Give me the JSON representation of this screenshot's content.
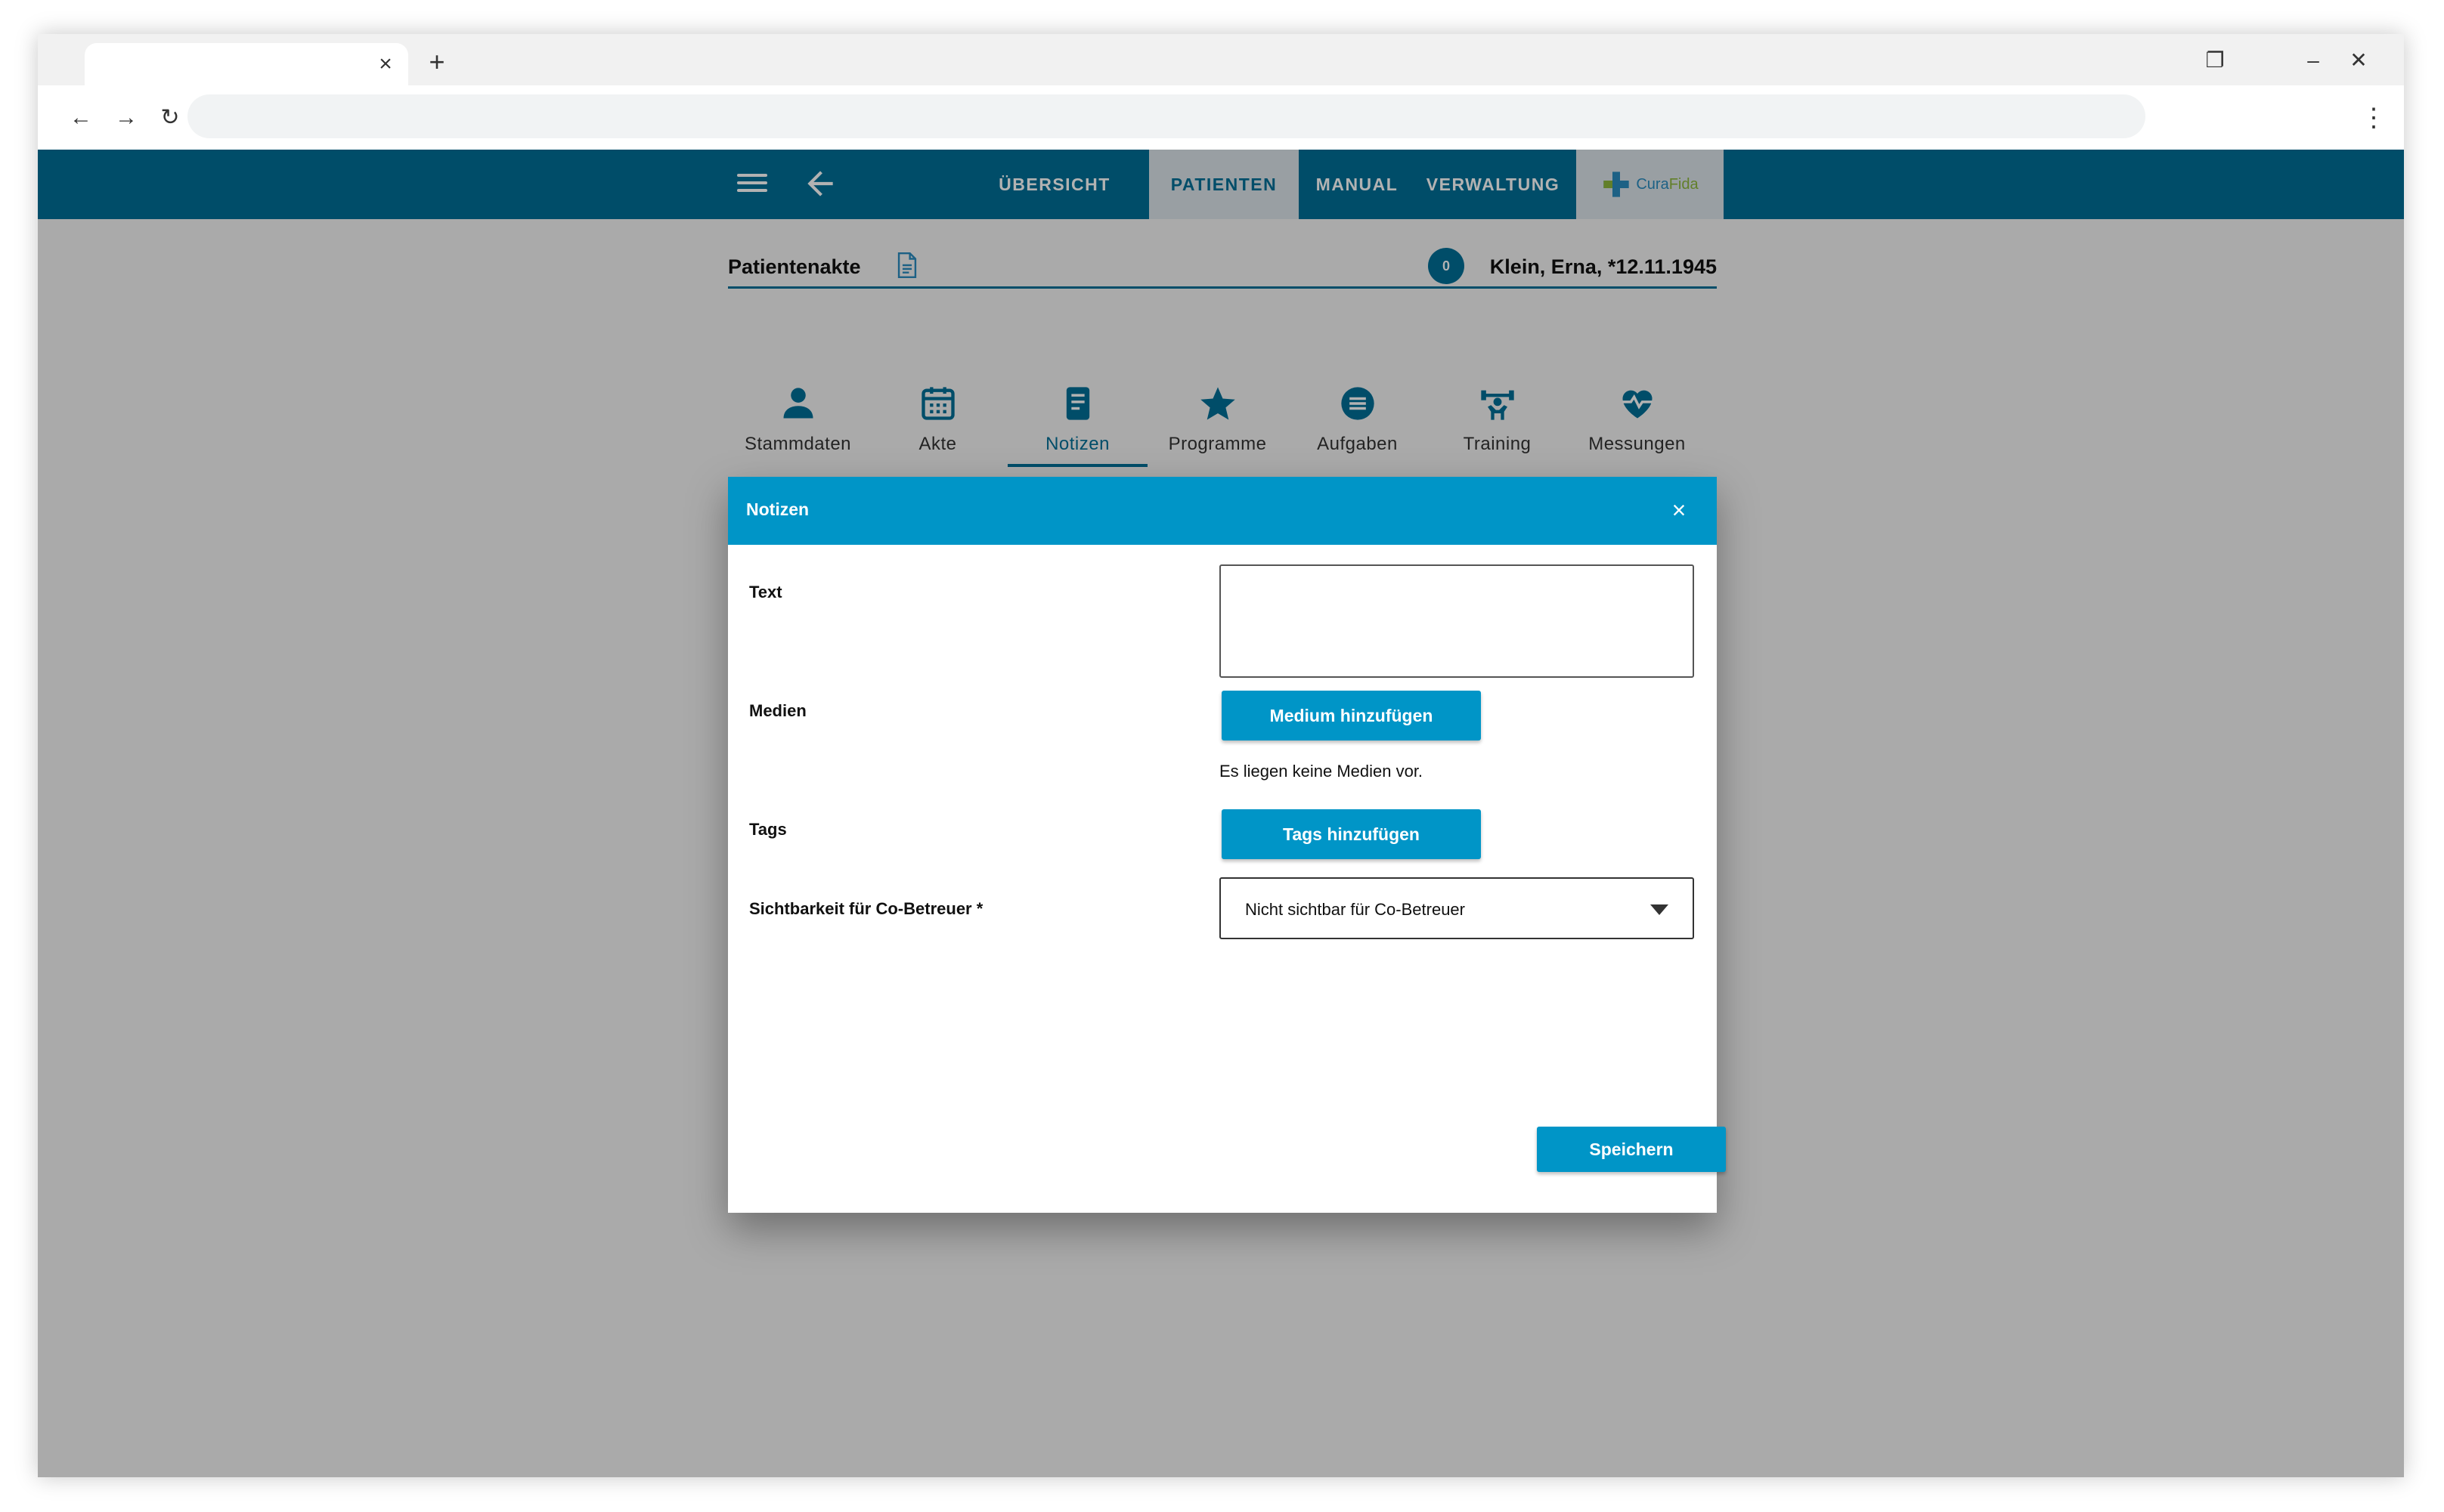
{
  "browser": {
    "tab_close": "×",
    "new_tab": "+",
    "minimize": "–",
    "restore": "❐",
    "close": "✕",
    "back": "←",
    "forward": "→",
    "reload": "↻",
    "menu": "⋮"
  },
  "nav": {
    "items": [
      {
        "label": "ÜBERSICHT"
      },
      {
        "label": "PATIENTEN"
      },
      {
        "label": "MANUAL"
      },
      {
        "label": "VERWALTUNG"
      }
    ],
    "brand_part1": "Cura",
    "brand_part2": "Fida"
  },
  "header": {
    "title": "Patientenakte",
    "badge": "0",
    "patient": "Klein, Erna, *12.11.1945"
  },
  "tabs": [
    {
      "label": "Stammdaten"
    },
    {
      "label": "Akte"
    },
    {
      "label": "Notizen"
    },
    {
      "label": "Programme"
    },
    {
      "label": "Aufgaben"
    },
    {
      "label": "Training"
    },
    {
      "label": "Messungen"
    }
  ],
  "dialog": {
    "title": "Notizen",
    "close": "×",
    "text_label": "Text",
    "media_label": "Medien",
    "media_button": "Medium hinzufügen",
    "media_note": "Es liegen keine Medien vor.",
    "tags_label": "Tags",
    "tags_button": "Tags hinzufügen",
    "visibility_label": "Sichtbarkeit für Co-Betreuer *",
    "visibility_value": "Nicht sichtbar für Co-Betreuer",
    "save_button": "Speichern"
  },
  "colors": {
    "appbar": "#006f97",
    "dialog_header": "#0095c7",
    "button": "#0095c7",
    "overlay": "#adadad"
  }
}
